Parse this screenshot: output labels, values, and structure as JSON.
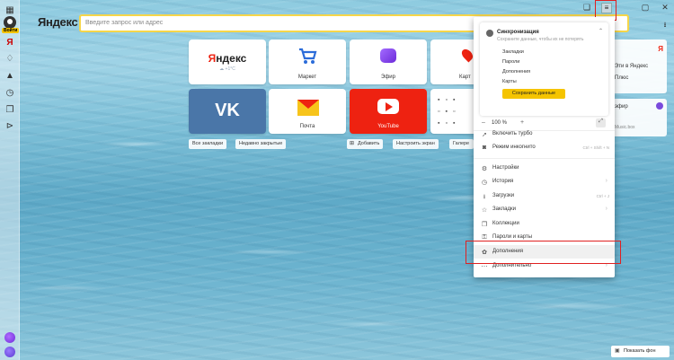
{
  "sidebar": {
    "login_label": "Войти",
    "icons": [
      "grid-icon",
      "yandex-y-icon",
      "bell-icon",
      "location-icon",
      "history-icon",
      "bookmarks-icon",
      "next-icon"
    ]
  },
  "browser": {
    "logo": "Яндекс",
    "search_placeholder": "Введите запрос или адрес"
  },
  "tiles": [
    {
      "label": "Яндекс",
      "weather": "☁ +1°С"
    },
    {
      "label": "Маркет"
    },
    {
      "label": "Эфир"
    },
    {
      "label": "Карт"
    },
    {
      "label": ""
    },
    {
      "label": "Почта"
    },
    {
      "label": "YouTube"
    },
    {
      "label": ""
    }
  ],
  "tile_buttons": {
    "all_bookmarks": "Все закладки",
    "recently_closed": "Недавно закрытые",
    "add": "Добавить",
    "customize": "Настроить экран",
    "gallery": "Галере"
  },
  "menu": {
    "sync": {
      "title": "Синхронизация",
      "desc": "Сохраните данные, чтобы их не потерять",
      "items": [
        "Закладки",
        "Пароли",
        "Дополнения",
        "Карты"
      ],
      "save_button": "Сохранить данные"
    },
    "zoom": {
      "minus": "–",
      "value": "100 %",
      "plus": "+"
    },
    "items": [
      {
        "label": "Включить турбо",
        "shortcut": "",
        "arrow": ""
      },
      {
        "label": "Режим инкогнито",
        "shortcut": "Ctrl + Shift + N",
        "arrow": ""
      },
      {
        "label": "Настройки",
        "shortcut": "",
        "arrow": ""
      },
      {
        "label": "История",
        "shortcut": "",
        "arrow": "›"
      },
      {
        "label": "Загрузки",
        "shortcut": "Ctrl + J",
        "arrow": ""
      },
      {
        "label": "Закладки",
        "shortcut": "",
        "arrow": "›"
      },
      {
        "label": "Коллекции",
        "shortcut": "",
        "arrow": ""
      },
      {
        "label": "Пароли и карты",
        "shortcut": "",
        "arrow": ""
      },
      {
        "label": "Дополнения",
        "shortcut": "",
        "arrow": ""
      },
      {
        "label": "Дополнительно",
        "shortcut": "",
        "arrow": "›"
      }
    ]
  },
  "right_panel": {
    "line1": "Яндекс",
    "line2": "Эти в Яндекс",
    "line3": "Плюс",
    "line4": "эфир",
    "line5": "Music.box"
  },
  "show_background": "Показать фон"
}
